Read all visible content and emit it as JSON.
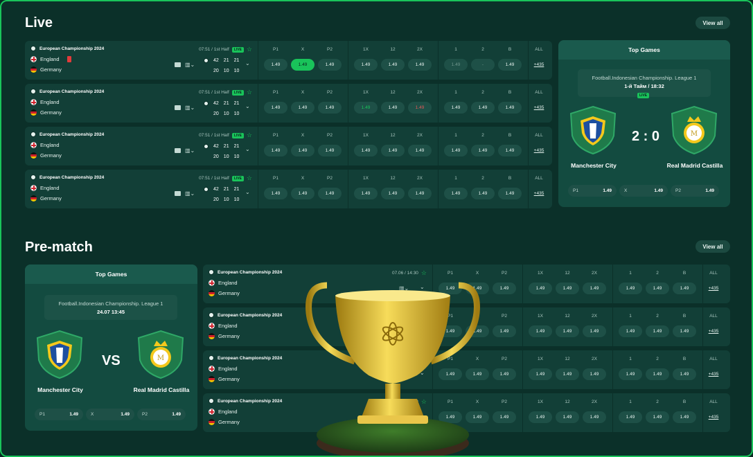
{
  "colors": {
    "accent": "#19c35a",
    "bg": "#0b3029",
    "row": "#123f37"
  },
  "live": {
    "title": "Live",
    "view_all": "View all",
    "rows": [
      {
        "league": "European Championship 2024",
        "time": "07:51 / 1st Half",
        "badge": "LIVE",
        "team1": "England",
        "team2": "Germany",
        "s1": [
          "42",
          "21",
          "21"
        ],
        "s2": [
          "20",
          "10",
          "10"
        ],
        "h1": [
          "P1",
          "X",
          "P2"
        ],
        "o1": [
          "1.49",
          "1.49",
          "1.49"
        ],
        "h2": [
          "1X",
          "12",
          "2X"
        ],
        "o2": [
          "1.49",
          "1.49",
          "1.49"
        ],
        "h3": [
          "1",
          "2",
          "B"
        ],
        "o3": [
          "1.49",
          "-",
          "1.49"
        ],
        "all": "ALL",
        "more": "+435"
      },
      {
        "league": "European Championship 2024",
        "time": "07:51 / 1st Half",
        "badge": "LIVE",
        "team1": "England",
        "team2": "Germany",
        "s1": [
          "42",
          "21",
          "21"
        ],
        "s2": [
          "20",
          "10",
          "10"
        ],
        "h1": [
          "P1",
          "X",
          "P2"
        ],
        "o1": [
          "1.49",
          "1.49",
          "1.49"
        ],
        "h2": [
          "1X",
          "12",
          "2X"
        ],
        "o2": [
          "1.49",
          "1.49",
          "1.49"
        ],
        "h3": [
          "1",
          "2",
          "B"
        ],
        "o3": [
          "1.49",
          "1.49",
          "1.49"
        ],
        "all": "ALL",
        "more": "+435"
      },
      {
        "league": "European Championship 2024",
        "time": "07:51 / 1st Half",
        "badge": "LIVE",
        "team1": "England",
        "team2": "Germany",
        "s1": [
          "42",
          "21",
          "21"
        ],
        "s2": [
          "20",
          "10",
          "10"
        ],
        "h1": [
          "P1",
          "X",
          "P2"
        ],
        "o1": [
          "1.49",
          "1.49",
          "1.49"
        ],
        "h2": [
          "1X",
          "12",
          "2X"
        ],
        "o2": [
          "1.49",
          "1.49",
          "1.49"
        ],
        "h3": [
          "1",
          "2",
          "B"
        ],
        "o3": [
          "1.49",
          "1.49",
          "1.49"
        ],
        "all": "ALL",
        "more": "+435"
      },
      {
        "league": "European Championship 2024",
        "time": "07:51 / 1st Half",
        "badge": "LIVE",
        "team1": "England",
        "team2": "Germany",
        "s1": [
          "42",
          "21",
          "21"
        ],
        "s2": [
          "20",
          "10",
          "10"
        ],
        "h1": [
          "P1",
          "X",
          "P2"
        ],
        "o1": [
          "1.49",
          "1.49",
          "1.49"
        ],
        "h2": [
          "1X",
          "12",
          "2X"
        ],
        "o2": [
          "1.49",
          "1.49",
          "1.49"
        ],
        "h3": [
          "1",
          "2",
          "B"
        ],
        "o3": [
          "1.49",
          "1.49",
          "1.49"
        ],
        "all": "ALL",
        "more": "+435"
      }
    ],
    "top_games": {
      "title": "Top Games",
      "league": "Football.Indonesian Championship. League 1",
      "time": "1-й Тайм / 18:32",
      "badge": "LIVE",
      "home": "Manchester City",
      "away": "Real Madrid Castilla",
      "score": "2 : 0",
      "odds": [
        {
          "label": "P1",
          "value": "1.49"
        },
        {
          "label": "X",
          "value": "1.49"
        },
        {
          "label": "P2",
          "value": "1.49"
        }
      ]
    }
  },
  "prematch": {
    "title": "Pre-match",
    "view_all": "View all",
    "top_games": {
      "title": "Top Games",
      "league": "Football.Indonesian Championship. League 1",
      "date": "24.07 13:45",
      "home": "Manchester City",
      "away": "Real Madrid Castilla",
      "vs": "VS",
      "odds": [
        {
          "label": "P1",
          "value": "1.49"
        },
        {
          "label": "X",
          "value": "1.49"
        },
        {
          "label": "P2",
          "value": "1.49"
        }
      ]
    },
    "rows": [
      {
        "league": "European Championship 2024",
        "time": "07.06 / 14:30",
        "team1": "England",
        "team2": "Germany",
        "h1": [
          "P1",
          "X",
          "P2"
        ],
        "o1": [
          "1.49",
          "1.49",
          "1.49"
        ],
        "h2": [
          "1X",
          "12",
          "2X"
        ],
        "o2": [
          "1.49",
          "1.49",
          "1.49"
        ],
        "h3": [
          "1",
          "2",
          "B"
        ],
        "o3": [
          "1.49",
          "1.49",
          "1.49"
        ],
        "all": "ALL",
        "more": "+435"
      },
      {
        "league": "European Championship 2024",
        "time": "",
        "team1": "England",
        "team2": "Germany",
        "h1": [
          "P1",
          "X",
          "P2"
        ],
        "o1": [
          "1.49",
          "1.49",
          "1.49"
        ],
        "h2": [
          "1X",
          "12",
          "2X"
        ],
        "o2": [
          "1.49",
          "1.49",
          "1.49"
        ],
        "h3": [
          "1",
          "2",
          "B"
        ],
        "o3": [
          "1.49",
          "1.49",
          "1.49"
        ],
        "all": "ALL",
        "more": "+435"
      },
      {
        "league": "European Championship 2024",
        "time": "",
        "team1": "England",
        "team2": "Germany",
        "h1": [
          "P1",
          "X",
          "P2"
        ],
        "o1": [
          "1.49",
          "1.49",
          "1.49"
        ],
        "h2": [
          "1X",
          "12",
          "2X"
        ],
        "o2": [
          "1.49",
          "1.49",
          "1.49"
        ],
        "h3": [
          "1",
          "2",
          "B"
        ],
        "o3": [
          "1.49",
          "1.49",
          "1.49"
        ],
        "all": "ALL",
        "more": "+435"
      },
      {
        "league": "European Championship 2024",
        "time": "07.06 / 14:30",
        "team1": "England",
        "team2": "Germany",
        "h1": [
          "P1",
          "X",
          "P2"
        ],
        "o1": [
          "1.49",
          "1.49",
          "1.49"
        ],
        "h2": [
          "1X",
          "12",
          "2X"
        ],
        "o2": [
          "1.49",
          "1.49",
          "1.49"
        ],
        "h3": [
          "1",
          "2",
          "B"
        ],
        "o3": [
          "1.49",
          "1.49",
          "1.49"
        ],
        "all": "ALL",
        "more": "+435"
      }
    ]
  }
}
